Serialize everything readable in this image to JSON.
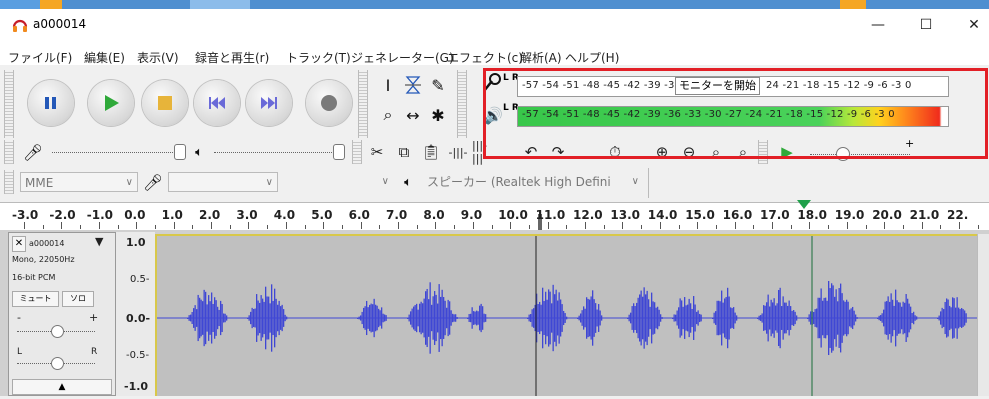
{
  "window": {
    "title": "a000014",
    "minimize": "—",
    "maximize": "☐",
    "close": "✕"
  },
  "menu": [
    "ファイル(F)",
    "編集(E)",
    "表示(V)",
    "録音と再生(r)",
    "トラック(T)",
    "ジェネレーター(G)",
    "エフェクト(c)",
    "解析(A)",
    "ヘルプ(H)"
  ],
  "meters": {
    "record_ticks": "-57 -54 -51 -48 -45 -42 -39 -3",
    "record_button": "モニターを開始",
    "record_ticks_right": "24 -21 -18 -15 -12  -9   -6   -3   0",
    "playback_ticks": "-57 -54 -51 -48 -45 -42 -39 -36 -33 -30 -27 -24 -21 -18 -15 -12  -9   -6   -3   0",
    "record_channel": "L R",
    "playback_channel": "L R"
  },
  "device": {
    "host": "MME",
    "output": "スピーカー (Realtek High Defini"
  },
  "mixer": {
    "play_speed_plus": "+"
  },
  "ruler": {
    "labels": [
      "-3.0",
      "-2.0",
      "-1.0",
      "0.0",
      "1.0",
      "2.0",
      "3.0",
      "4.0",
      "5.0",
      "6.0",
      "7.0",
      "8.0",
      "9.0",
      "10.0",
      "11.0",
      "12.0",
      "13.0",
      "14.0",
      "15.0",
      "16.0",
      "17.0",
      "18.0",
      "19.0",
      "20.0",
      "21.0",
      "22."
    ]
  },
  "track": {
    "name": "a000014",
    "info1": "Mono, 22050Hz",
    "info2": "16-bit PCM",
    "mute": "ミュート",
    "solo": "ソロ",
    "gain_minus": "-",
    "gain_plus": "+",
    "pan_left": "L",
    "pan_right": "R",
    "collapse": "▲",
    "scale": [
      "1.0",
      "0.5-",
      "0.0-",
      "-0.5-",
      "-1.0"
    ]
  },
  "colors": {
    "waveform": "#3f47d4",
    "highlight_box": "#e21f26",
    "meter_green": "#4ad25a"
  }
}
